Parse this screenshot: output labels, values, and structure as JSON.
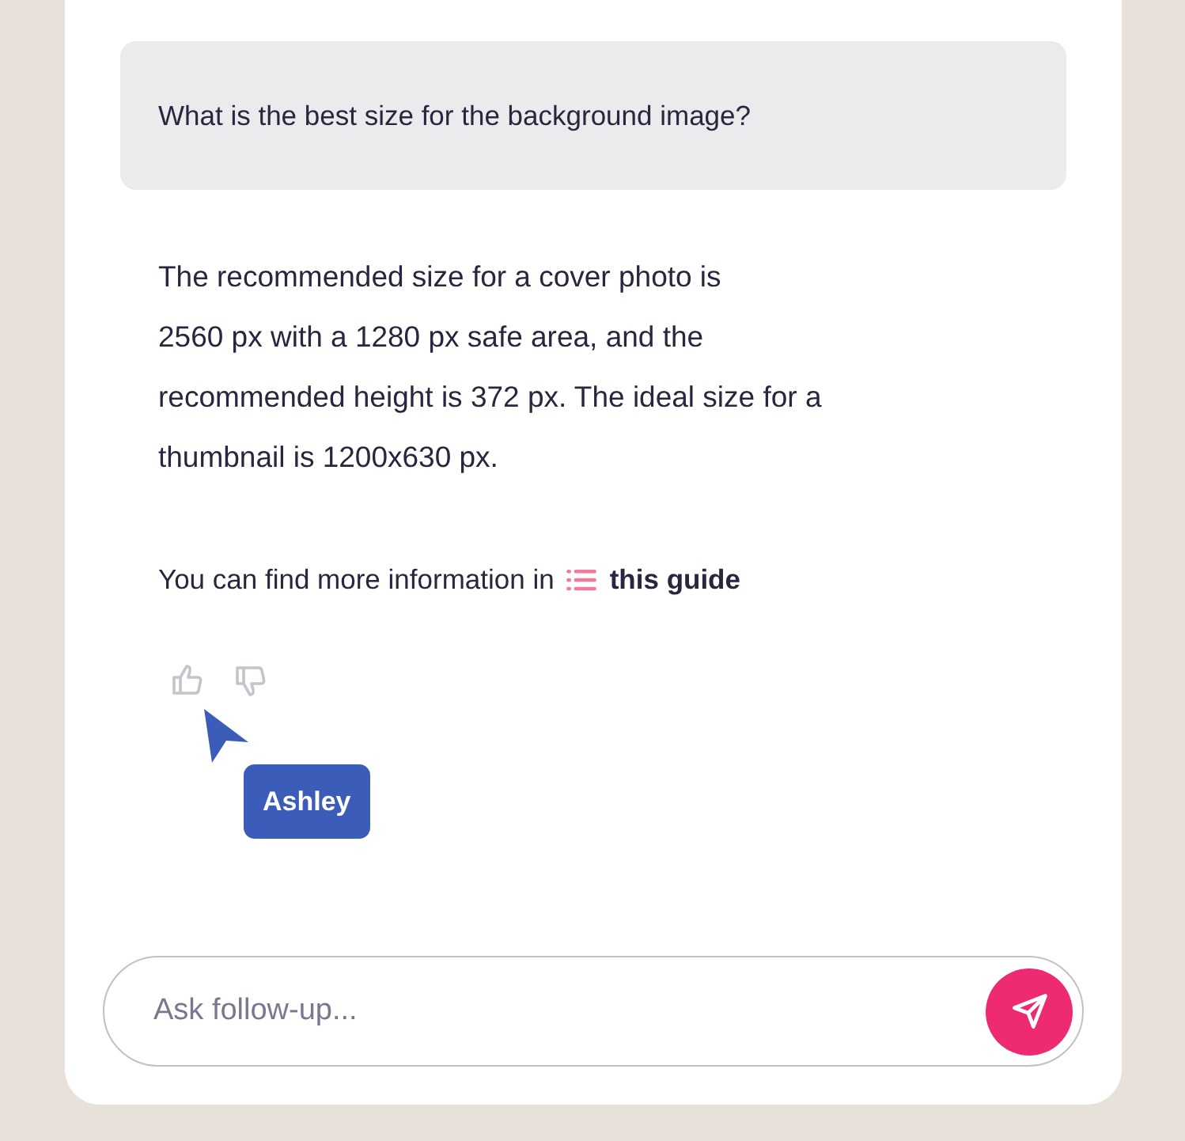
{
  "question": "What is the best size for the background image?",
  "answer": "The recommended size for a cover photo is\n2560 px with a 1280 px safe area, and the recommended height is 372 px. The ideal size for a thumbnail is 1200x630 px.",
  "more_info": {
    "text": "You can find more information in",
    "link": "this guide"
  },
  "cursor": {
    "label": "Ashley"
  },
  "input": {
    "placeholder": "Ask follow-up..."
  }
}
